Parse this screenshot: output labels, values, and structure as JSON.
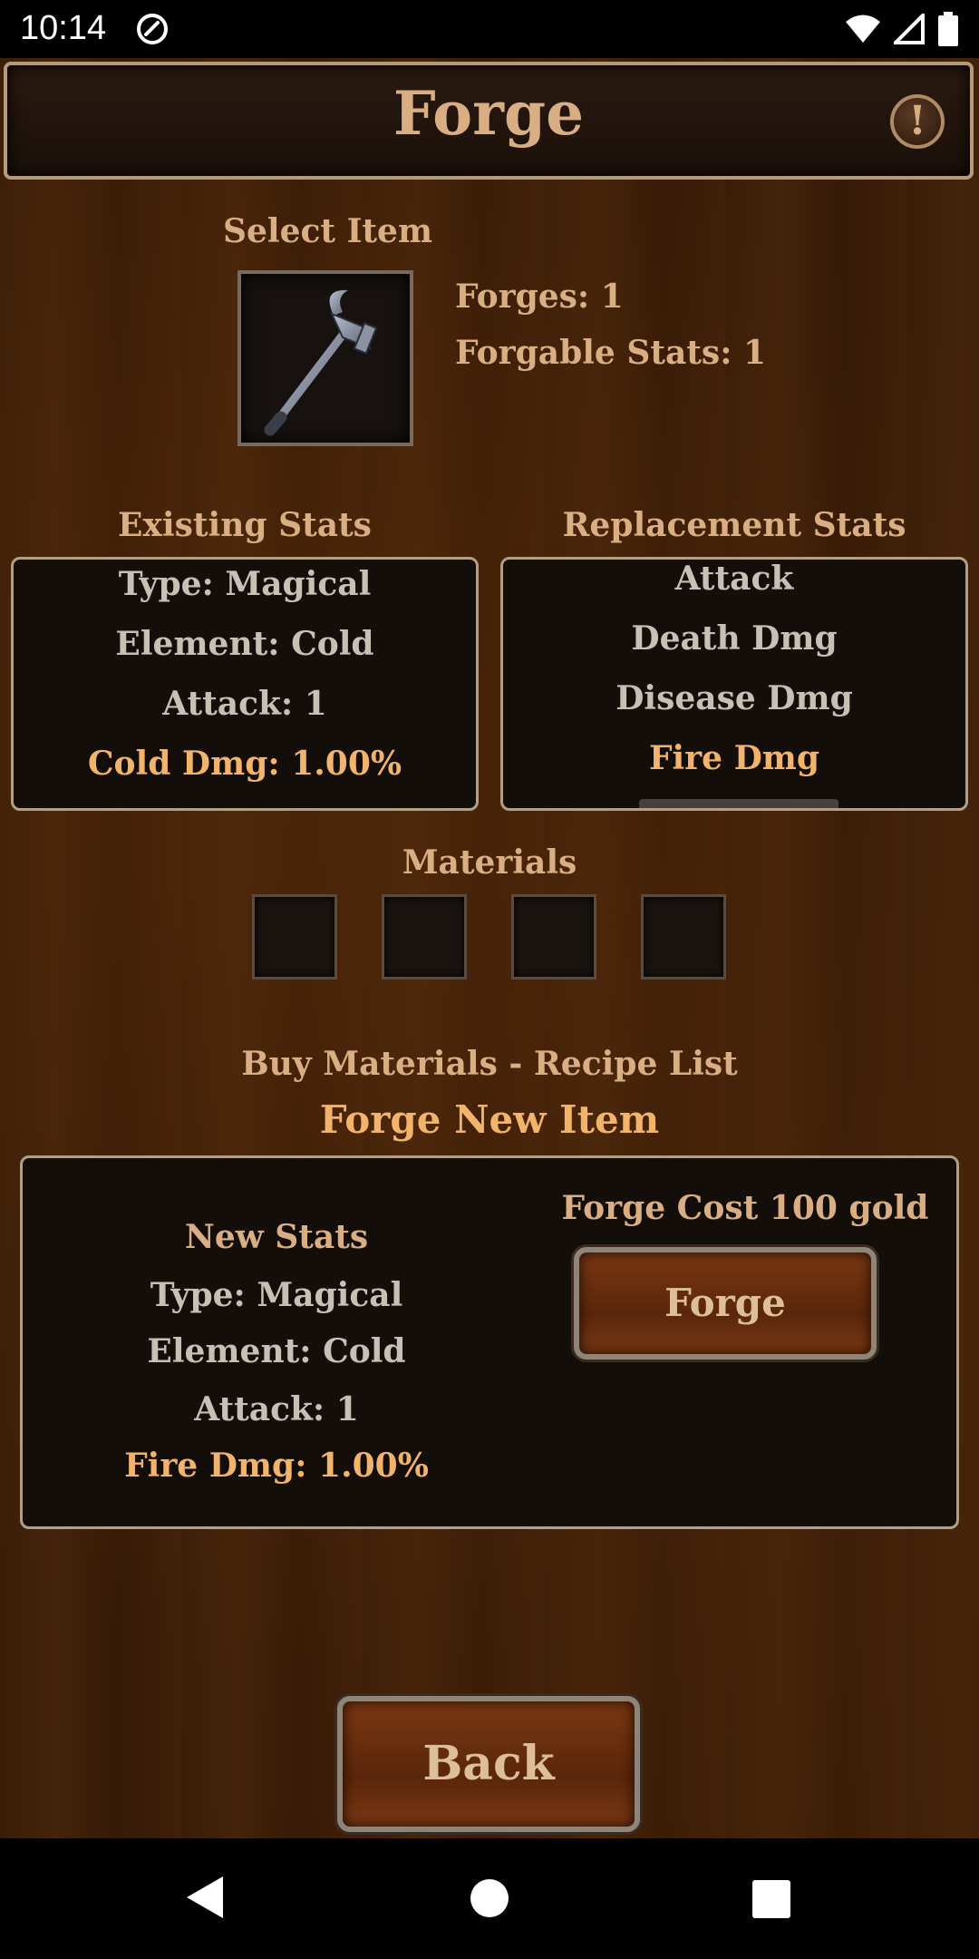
{
  "status_bar": {
    "time": "10:14"
  },
  "header": {
    "title": "Forge",
    "info_label": "!"
  },
  "item": {
    "select_label": "Select Item",
    "forges": "Forges: 1",
    "forgable_stats": "Forgable Stats: 1"
  },
  "existing": {
    "label": "Existing Stats",
    "lines": [
      "Type: Magical",
      "Element: Cold",
      "Attack: 1",
      "Cold Dmg: 1.00%"
    ]
  },
  "replacement": {
    "label": "Replacement Stats",
    "options": [
      "Attack",
      "Death Dmg",
      "Disease Dmg",
      "Fire Dmg"
    ],
    "selected": "Fire Dmg"
  },
  "materials": {
    "label": "Materials",
    "link": "Buy Materials - Recipe List"
  },
  "forge_new": {
    "heading": "Forge New Item",
    "new_stats_label": "New Stats",
    "lines": [
      "Type: Magical",
      "Element: Cold",
      "Attack: 1",
      "Fire Dmg: 1.00%"
    ],
    "cost": "Forge Cost 100 gold",
    "button": "Forge"
  },
  "footer": {
    "back_button": "Back"
  },
  "colors": {
    "gold_text": "#d8ae82",
    "highlight_text": "#f2b36b",
    "stat_text": "#c8c0b4"
  }
}
